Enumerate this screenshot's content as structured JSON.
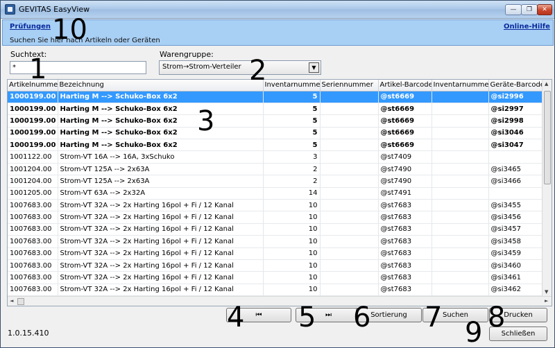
{
  "window": {
    "title": "GEVITAS EasyView",
    "minimize_glyph": "—",
    "restore_glyph": "❐",
    "close_glyph": "✕"
  },
  "banner": {
    "title_link": "Prüfungen",
    "help_link": "Online-Hilfe",
    "subtitle": "Suchen Sie hier nach Artikeln oder Geräten"
  },
  "search": {
    "label": "Suchtext:",
    "value": "*"
  },
  "group": {
    "label": "Warengruppe:",
    "selected": "Strom→Strom-Verteiler",
    "arrow_glyph": "▼"
  },
  "table": {
    "columns": [
      "Artikelnummer",
      "Bezeichnung",
      "Inventarnummer",
      "Seriennummer",
      "Artikel-Barcode",
      "Inventarnummer",
      "Geräte-Barcode"
    ],
    "rows": [
      [
        "1000199.00",
        "Harting M --> Schuko-Box 6x2",
        "5",
        "",
        "@st6669",
        "",
        "@si2996"
      ],
      [
        "1000199.00",
        "Harting M --> Schuko-Box 6x2",
        "5",
        "",
        "@st6669",
        "",
        "@si2997"
      ],
      [
        "1000199.00",
        "Harting M --> Schuko-Box 6x2",
        "5",
        "",
        "@st6669",
        "",
        "@si2998"
      ],
      [
        "1000199.00",
        "Harting M --> Schuko-Box 6x2",
        "5",
        "",
        "@st6669",
        "",
        "@si3046"
      ],
      [
        "1000199.00",
        "Harting M --> Schuko-Box 6x2",
        "5",
        "",
        "@st6669",
        "",
        "@si3047"
      ],
      [
        "1001122.00",
        "Strom-VT 16A --> 16A, 3xSchuko",
        "3",
        "",
        "@st7409",
        "",
        ""
      ],
      [
        "1001204.00",
        "Strom-VT 125A --> 2x63A",
        "2",
        "",
        "@st7490",
        "",
        "@si3465"
      ],
      [
        "1001204.00",
        "Strom-VT 125A --> 2x63A",
        "2",
        "",
        "@st7490",
        "",
        "@si3466"
      ],
      [
        "1001205.00",
        "Strom-VT 63A --> 2x32A",
        "14",
        "",
        "@st7491",
        "",
        ""
      ],
      [
        "1007683.00",
        "Strom-VT 32A --> 2x Harting 16pol + Fi / 12 Kanal",
        "10",
        "",
        "@st7683",
        "",
        "@si3455"
      ],
      [
        "1007683.00",
        "Strom-VT 32A --> 2x Harting 16pol + Fi / 12 Kanal",
        "10",
        "",
        "@st7683",
        "",
        "@si3456"
      ],
      [
        "1007683.00",
        "Strom-VT 32A --> 2x Harting 16pol + Fi / 12 Kanal",
        "10",
        "",
        "@st7683",
        "",
        "@si3457"
      ],
      [
        "1007683.00",
        "Strom-VT 32A --> 2x Harting 16pol + Fi / 12 Kanal",
        "10",
        "",
        "@st7683",
        "",
        "@si3458"
      ],
      [
        "1007683.00",
        "Strom-VT 32A --> 2x Harting 16pol + Fi / 12 Kanal",
        "10",
        "",
        "@st7683",
        "",
        "@si3459"
      ],
      [
        "1007683.00",
        "Strom-VT 32A --> 2x Harting 16pol + Fi / 12 Kanal",
        "10",
        "",
        "@st7683",
        "",
        "@si3460"
      ],
      [
        "1007683.00",
        "Strom-VT 32A --> 2x Harting 16pol + Fi / 12 Kanal",
        "10",
        "",
        "@st7683",
        "",
        "@si3461"
      ],
      [
        "1007683.00",
        "Strom-VT 32A --> 2x Harting 16pol + Fi / 12 Kanal",
        "10",
        "",
        "@st7683",
        "",
        "@si3462"
      ]
    ],
    "selected_row": 0,
    "bold_rows": [
      0,
      1,
      2,
      3,
      4
    ]
  },
  "scroll_arrows": {
    "up": "▲",
    "down": "▼",
    "left": "◄",
    "right": "►"
  },
  "buttons": {
    "first": "⏮",
    "last": "⏭",
    "sort": "Sortierung",
    "search": "Suchen",
    "print": "Drucken",
    "close": "Schließen"
  },
  "version": "1.0.15.410",
  "annotations": {
    "n1": "1",
    "n2": "2",
    "n3": "3",
    "n4": "4",
    "n5": "5",
    "n6": "6",
    "n7": "7",
    "n8": "8",
    "n9": "9",
    "n10": "10"
  }
}
